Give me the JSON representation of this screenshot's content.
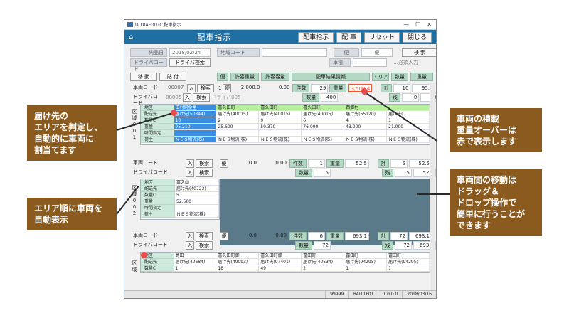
{
  "window": {
    "title": "ULTRAFDUTC 配車指示",
    "header": "配車指示",
    "buttons": [
      "配車指示",
      "配 車",
      "リセット",
      "閉じる"
    ]
  },
  "filters": {
    "date_label": "納品日",
    "date": "2018/02/24",
    "area_label": "地域コード",
    "driver_label": "ドライバコード",
    "driver_search": "ドライバ検索",
    "flight_label": "便",
    "flight": "便",
    "vehicle_label": "車種",
    "search": "検 索",
    "required": "…必須入力"
  },
  "toolbar": {
    "move": "移 動",
    "paste": "貼 付"
  },
  "headers": {
    "flight": "便",
    "allow_weight": "許容重量",
    "allow_volume": "許容容量",
    "result": "配車結果情報",
    "area": "エリア",
    "qty": "数量",
    "weight": "重量"
  },
  "vehicle1": {
    "code_label": "車両コード",
    "code": "00007",
    "in": "入",
    "search": "検索",
    "driver_label": "ドライバコード",
    "driver": "80005",
    "driver_name": "ドライバ005",
    "flight": "1",
    "flight_btn": "便",
    "allow": "2,000.0",
    "vol": "0.00",
    "count_label": "件数",
    "count": "29",
    "wt_label": "重量",
    "wt": "3,500.4",
    "qty_label": "数量",
    "qty": "400",
    "total_label": "計",
    "total_n": "10",
    "total_w": "95.2",
    "rest_label": "残",
    "rest_n": "0",
    "rest_w": "0.00"
  },
  "grid1": {
    "labels": [
      "地区",
      "配送先",
      "数量C",
      "重量",
      "時間指定",
      "荷主"
    ],
    "cols": [
      [
        "田村同金屋",
        "届け先(50844)",
        "10",
        "95.210",
        "",
        "ＮＥＳ物流(株)"
      ],
      [
        "喜久田町",
        "届け先(40015)",
        "2",
        "25.600",
        "",
        "ＮＥＳ物流(株)"
      ],
      [
        "喜久田町",
        "届け先(40015)",
        "9",
        "50.370",
        "",
        "ＮＥＳ物流(株)"
      ],
      [
        "喜久田町",
        "届け先(40015)",
        "6",
        "76.000",
        "",
        "ＮＥＳ物流(株)"
      ],
      [
        "西郷村",
        "届け先(55120)",
        "4",
        "43.000",
        "",
        "ＮＥＳ物流(株)"
      ],
      [
        "",
        "届け先(…",
        "1",
        "21.000",
        "",
        "ＮＥＳ物流(株)"
      ]
    ]
  },
  "vehicle2": {
    "code_label": "車両コード",
    "in": "入",
    "search": "検索",
    "driver_label": "ドライバコード",
    "flight_btn": "便",
    "allow": "0.0",
    "vol": "0.00",
    "count_label": "件数",
    "count": "1",
    "wt_label": "重量",
    "wt": "52.5",
    "qty_label": "数量",
    "qty": "5",
    "total_label": "計",
    "total_n": "5",
    "total_w": "52.5",
    "rest_label": "残",
    "rest_n": "5",
    "rest_w": "52.5"
  },
  "grid2": {
    "labels": [
      "地区",
      "配送先",
      "数量C",
      "重量",
      "時間指定",
      "荷主"
    ],
    "col": [
      "冨久山",
      "届け先(40723)",
      "5",
      "52.500",
      "",
      "ＮＥＳ物流(株)"
    ]
  },
  "vehicle3": {
    "code_label": "車両コード",
    "in": "入",
    "search": "検索",
    "driver_label": "ドライバコード",
    "flight_btn": "便",
    "allow": "0.0",
    "vol": "0.00",
    "count_label": "件数",
    "count": "6",
    "wt_label": "重量",
    "wt": "693.1",
    "qty_label": "数量",
    "qty": "72",
    "total_label": "計",
    "total_n": "72",
    "total_w": "693.1",
    "rest_label": "残",
    "rest_n": "72",
    "rest_w": "693.1"
  },
  "grid3": {
    "labels": [
      "地区",
      "配送先",
      "数量C"
    ],
    "cols": [
      [
        "島田",
        "届け先(40684)",
        "1"
      ],
      [
        "喜久田町御",
        "届け先(40093)",
        "18"
      ],
      [
        "喜久田町御",
        "届け先(97401)",
        "49"
      ],
      [
        "富田町",
        "届け先(40534)",
        "2"
      ],
      [
        "富田町",
        "届け先(94295)",
        "1"
      ],
      [
        "富田町",
        "届け先(94295)",
        "1"
      ]
    ]
  },
  "area_text": [
    "区",
    "域",
    "0",
    "0",
    "1"
  ],
  "status": [
    "99999",
    "HAI11F01",
    "1.0.0.0",
    "2018/03/16"
  ],
  "callouts": {
    "c1": "届け先の\nエリアを判定し、\n自動的に車両に\n割当てます",
    "c2": "エリア順に車両を\n自動表示",
    "c3": "車両の積載\n重量オーバーは\n赤で表示します",
    "c4": "車両間の移動は\nドラッグ＆\nドロップ操作で\n簡単に行うことが\nできます"
  }
}
